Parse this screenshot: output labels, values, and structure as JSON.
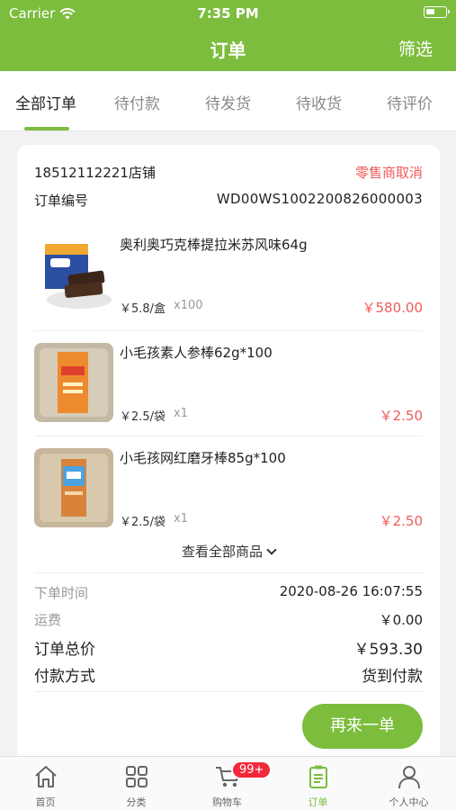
{
  "status_bar": {
    "carrier": "Carrier",
    "time": "7:35 PM"
  },
  "nav": {
    "title": "订单",
    "filter": "筛选"
  },
  "tabs": [
    {
      "label": "全部订单",
      "active": true
    },
    {
      "label": "待付款"
    },
    {
      "label": "待发货"
    },
    {
      "label": "待收货"
    },
    {
      "label": "待评价"
    }
  ],
  "order": {
    "shop": "18512112221店铺",
    "status": "零售商取消",
    "number_label": "订单编号",
    "number": "WD00WS1002200826000003",
    "items": [
      {
        "name": "奥利奥巧克棒提拉米苏风味64g",
        "price": "￥5.8/盒",
        "qty": "x100",
        "subtotal": "￥580.00"
      },
      {
        "name": "小毛孩素人参棒62g*100",
        "price": "￥2.5/袋",
        "qty": "x1",
        "subtotal": "￥2.50"
      },
      {
        "name": "小毛孩网红磨牙棒85g*100",
        "price": "￥2.5/袋",
        "qty": "x1",
        "subtotal": "￥2.50"
      }
    ],
    "view_all": "查看全部商品",
    "order_time_label": "下单时间",
    "order_time": "2020-08-26 16:07:55",
    "shipping_label": "运费",
    "shipping": "￥0.00",
    "total_label": "订单总价",
    "total": "￥593.30",
    "payment_label": "付款方式",
    "payment": "货到付款",
    "reorder": "再来一单"
  },
  "tabbar": [
    {
      "label": "首页",
      "icon": "home-icon"
    },
    {
      "label": "分类",
      "icon": "grid-icon"
    },
    {
      "label": "购物车",
      "icon": "cart-icon",
      "badge": "99+"
    },
    {
      "label": "订单",
      "icon": "order-icon",
      "active": true
    },
    {
      "label": "个人中心",
      "icon": "person-icon"
    }
  ],
  "colors": {
    "brand": "#7cbd3d",
    "alert": "#f05a5a",
    "badge": "#f2283b"
  }
}
